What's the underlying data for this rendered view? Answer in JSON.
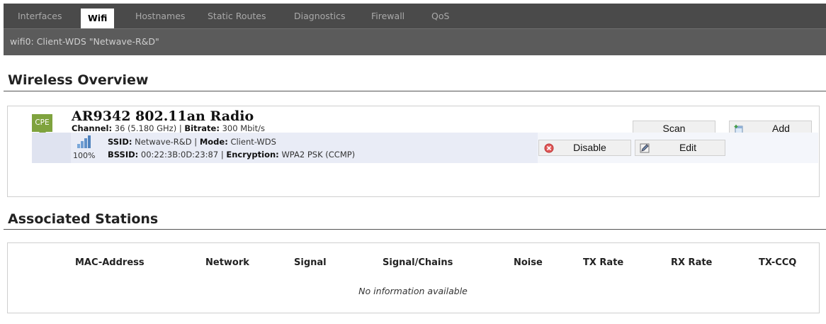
{
  "tabs": [
    {
      "label": "Interfaces",
      "active": false
    },
    {
      "label": "Wifi",
      "active": true
    },
    {
      "label": "Hostnames",
      "active": false
    },
    {
      "label": "Static Routes",
      "active": false
    },
    {
      "label": "Diagnostics",
      "active": false
    },
    {
      "label": "Firewall",
      "active": false
    },
    {
      "label": "QoS",
      "active": false
    }
  ],
  "subnav": {
    "item": "wifi0: Client-WDS \"Netwave-R&D\""
  },
  "overview": {
    "title": "Wireless Overview",
    "badge": "CPE",
    "radio_name": "AR9342 802.11an Radio",
    "channel_label": "Channel:",
    "channel_value": "36 (5.180 GHz)",
    "bitrate_label": "Bitrate:",
    "bitrate_value": "300 Mbit/s",
    "scan_label": "Scan",
    "add_label": "Add",
    "network": {
      "signal_pct": "100%",
      "ssid_label": "SSID:",
      "ssid_value": "Netwave-R&D",
      "mode_label": "Mode:",
      "mode_value": "Client-WDS",
      "bssid_label": "BSSID:",
      "bssid_value": "00:22:3B:0D:23:87",
      "enc_label": "Encryption:",
      "enc_value": "WPA2 PSK (CCMP)",
      "disable_label": "Disable",
      "edit_label": "Edit",
      "signal_level": 1.0
    }
  },
  "stations": {
    "title": "Associated Stations",
    "columns": [
      "MAC-Address",
      "Network",
      "Signal",
      "Signal/Chains",
      "Noise",
      "TX Rate",
      "RX Rate",
      "TX-CCQ"
    ],
    "empty_message": "No information available"
  },
  "colors": {
    "tabbar_bg": "#4a4a4a",
    "subbar_bg": "#5b5b5b",
    "badge_green": "#7fa33e",
    "network_row_bg": "#e9ecf6"
  }
}
